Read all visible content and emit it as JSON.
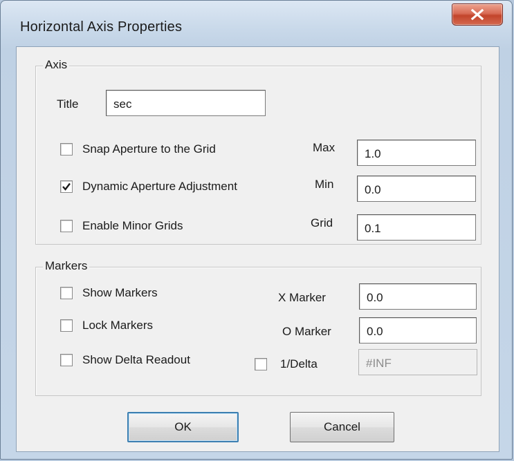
{
  "window": {
    "title": "Horizontal Axis Properties",
    "close_icon": "close-icon"
  },
  "axis_group": {
    "label": "Axis",
    "title_label": "Title",
    "title_value": "sec",
    "checkboxes": [
      {
        "label": "Snap Aperture to the Grid",
        "checked": false
      },
      {
        "label": "Dynamic Aperture Adjustment",
        "checked": true
      },
      {
        "label": "Enable Minor Grids",
        "checked": false
      }
    ],
    "fields": [
      {
        "label": "Max",
        "value": "1.0"
      },
      {
        "label": "Min",
        "value": "0.0"
      },
      {
        "label": "Grid",
        "value": "0.1"
      }
    ]
  },
  "markers_group": {
    "label": "Markers",
    "checkboxes": [
      {
        "label": "Show Markers",
        "checked": false
      },
      {
        "label": "Lock Markers",
        "checked": false
      },
      {
        "label": "Show Delta Readout",
        "checked": false
      }
    ],
    "fields": [
      {
        "label": "X Marker",
        "value": "0.0"
      },
      {
        "label": "O Marker",
        "value": "0.0"
      }
    ],
    "inverse_delta": {
      "label": "1/Delta",
      "checked": false,
      "value": "#INF"
    }
  },
  "buttons": {
    "ok": "OK",
    "cancel": "Cancel"
  }
}
